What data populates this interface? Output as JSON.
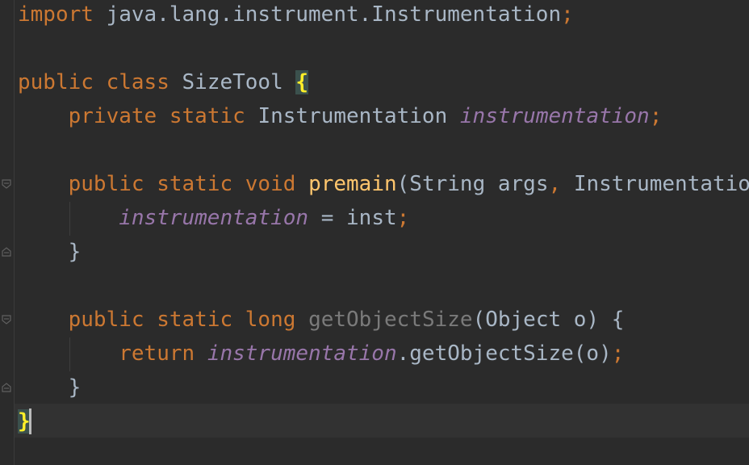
{
  "editor": {
    "language": "java",
    "colors": {
      "background": "#2b2b2b",
      "current_line": "#323232",
      "keyword": "#cc7832",
      "plain": "#a9b7c6",
      "field": "#9876aa",
      "method_declaration": "#ffc66d",
      "unused": "#7a7a7a",
      "matched_brace": "#ffef28"
    },
    "lines": {
      "l1": {
        "kw_import": "import",
        "path": "java.lang.instrument.Instrumentation",
        "semi": ";"
      },
      "l3": {
        "kw_public": "public",
        "kw_class": "class",
        "class_name": "SizeTool",
        "open_brace": "{"
      },
      "l4": {
        "kw_private": "private",
        "kw_static": "static",
        "type": "Instrumentation",
        "field": "instrumentation",
        "semi": ";"
      },
      "l6": {
        "kw_public": "public",
        "kw_static": "static",
        "kw_void": "void",
        "method": "premain",
        "open_paren": "(",
        "param_type": "String",
        "param_name": "args",
        "comma": ",",
        "param2_type": "Instrumentatio"
      },
      "l7": {
        "field": "instrumentation",
        "assign": "=",
        "value": "inst",
        "semi": ";"
      },
      "l8": {
        "close_brace": "}"
      },
      "l10": {
        "kw_public": "public",
        "kw_static": "static",
        "kw_long": "long",
        "method": "getObjectSize",
        "params": "(Object o)",
        "open_brace": "{"
      },
      "l11": {
        "kw_return": "return",
        "field": "instrumentation",
        "call": ".getObjectSize(o)",
        "semi": ";"
      },
      "l12": {
        "close_brace": "}"
      },
      "l13": {
        "close_brace": "}"
      }
    }
  }
}
